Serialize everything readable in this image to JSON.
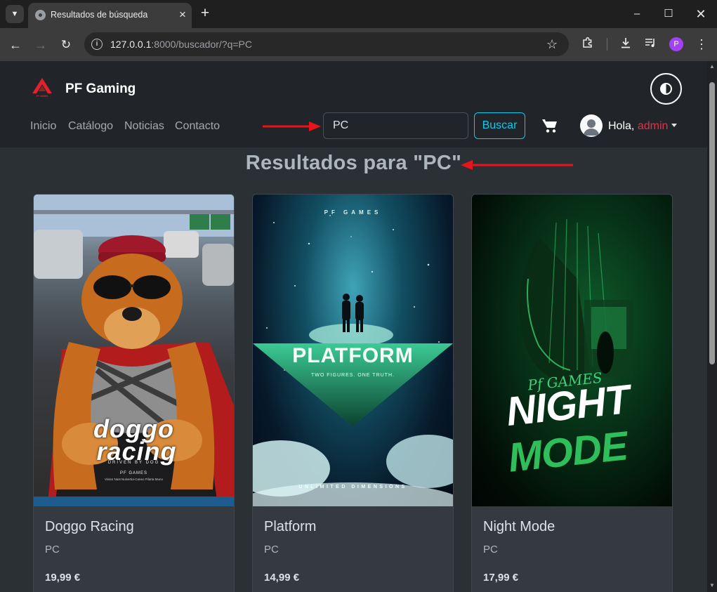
{
  "browser": {
    "tab_title": "Resultados de búsqueda",
    "url_host": "127.0.0.1",
    "url_path": ":8000/buscador/?q=PC",
    "profile_initial": "P"
  },
  "site": {
    "brand": "PF Gaming",
    "logo_text": "PF GAMES",
    "nav": [
      "Inicio",
      "Catálogo",
      "Noticias",
      "Contacto"
    ],
    "search_value": "PC",
    "search_button": "Buscar",
    "greeting": "Hola,",
    "username": "admin"
  },
  "results_title": "Resultados para \"PC\"",
  "products": [
    {
      "title": "Doggo Racing",
      "platform": "PC",
      "price": "19,99 €",
      "cover_line1": "doggo",
      "cover_line2": "racing",
      "cover_tagline": "DRIVEN BY DOG",
      "cover_studio": "PF GAMES",
      "cover_credits": "Vivian Nast Nulvertia-Caneo Pilarta Muno"
    },
    {
      "title": "Platform",
      "platform": "PC",
      "price": "14,99 €",
      "cover_studio": "PF GAMES",
      "cover_title": "PLATFORM",
      "cover_tagline": "TWO FIGURES. ONE TRUTH.",
      "cover_footer": "UNLIMITED DIMENSIONS"
    },
    {
      "title": "Night Mode",
      "platform": "PC",
      "price": "17,99 €",
      "cover_studio": "Pf GAMES",
      "cover_line1": "NIGHT",
      "cover_line2": "MODE"
    }
  ],
  "colors": {
    "navbar_bg": "#212529",
    "page_bg": "#2b3035",
    "card_bg": "#343a40",
    "accent_info": "#0dcaf0",
    "username": "#dc3545",
    "annotation_arrow": "#e8141b"
  }
}
